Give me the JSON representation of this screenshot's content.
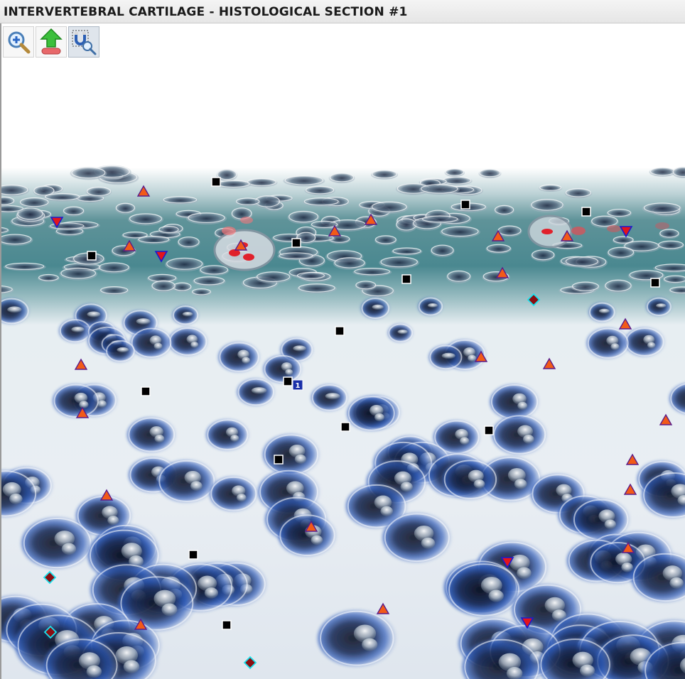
{
  "window": {
    "title": "INTERVERTEBRAL CARTILAGE - HISTOLOGICAL SECTION #1"
  },
  "toolbar": {
    "buttons": [
      {
        "name": "zoom-in-button",
        "icon": "magnifier-plus-icon"
      },
      {
        "name": "upload-button",
        "icon": "green-up-arrow-icon"
      },
      {
        "name": "magnet-select-button",
        "icon": "magnet-magnifier-icon",
        "active": true
      }
    ]
  },
  "colors": {
    "triangle_up_fill": "#f25a18",
    "triangle_up_stroke": "#5a1d8a",
    "triangle_down_fill": "#e3141b",
    "triangle_down_stroke": "#1a1ad0",
    "square_fill": "#000000",
    "square_stroke": "#ffffff",
    "diamond_fill": "#8b0f12",
    "diamond_stroke": "#19e3ee",
    "badge_fill": "#1a2fa8",
    "teal_layer": "#3f7f86",
    "cell_dark": "#162036",
    "cell_blue": "#2b58c2"
  },
  "markers": {
    "badge_label": "1"
  }
}
